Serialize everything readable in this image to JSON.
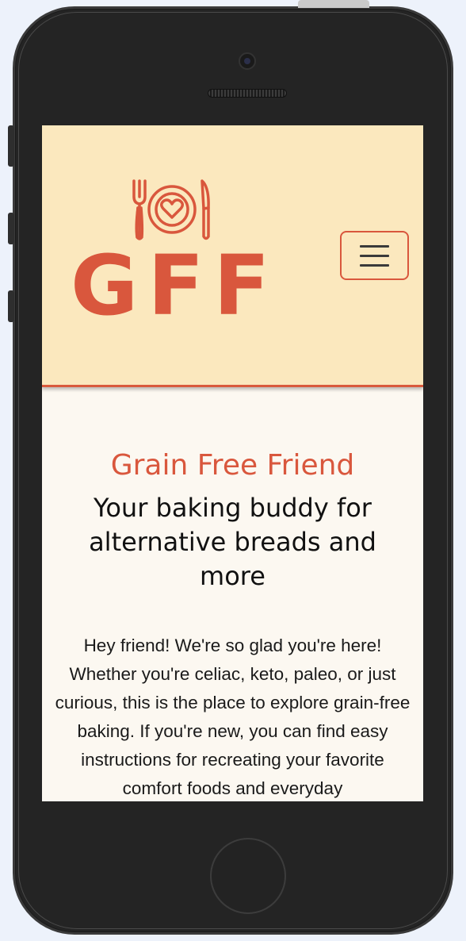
{
  "site": {
    "logo_text": "GFF",
    "logo_icon": "plate-heart-fork-knife-icon",
    "menu_icon": "hamburger-menu-icon",
    "title": "Grain Free Friend",
    "tagline": "Your baking buddy for alternative breads and more",
    "intro": "Hey friend! We're so glad you're here! Whether you're celiac, keto, paleo, or just curious, this is the place to explore grain-free baking. If you're new, you can find easy instructions for recreating your favorite comfort foods and everyday"
  },
  "colors": {
    "accent": "#d9573d",
    "header_bg": "#fbe8be",
    "page_bg": "#fcf8f1",
    "device_body": "#242424",
    "backdrop": "#edf2fb"
  }
}
